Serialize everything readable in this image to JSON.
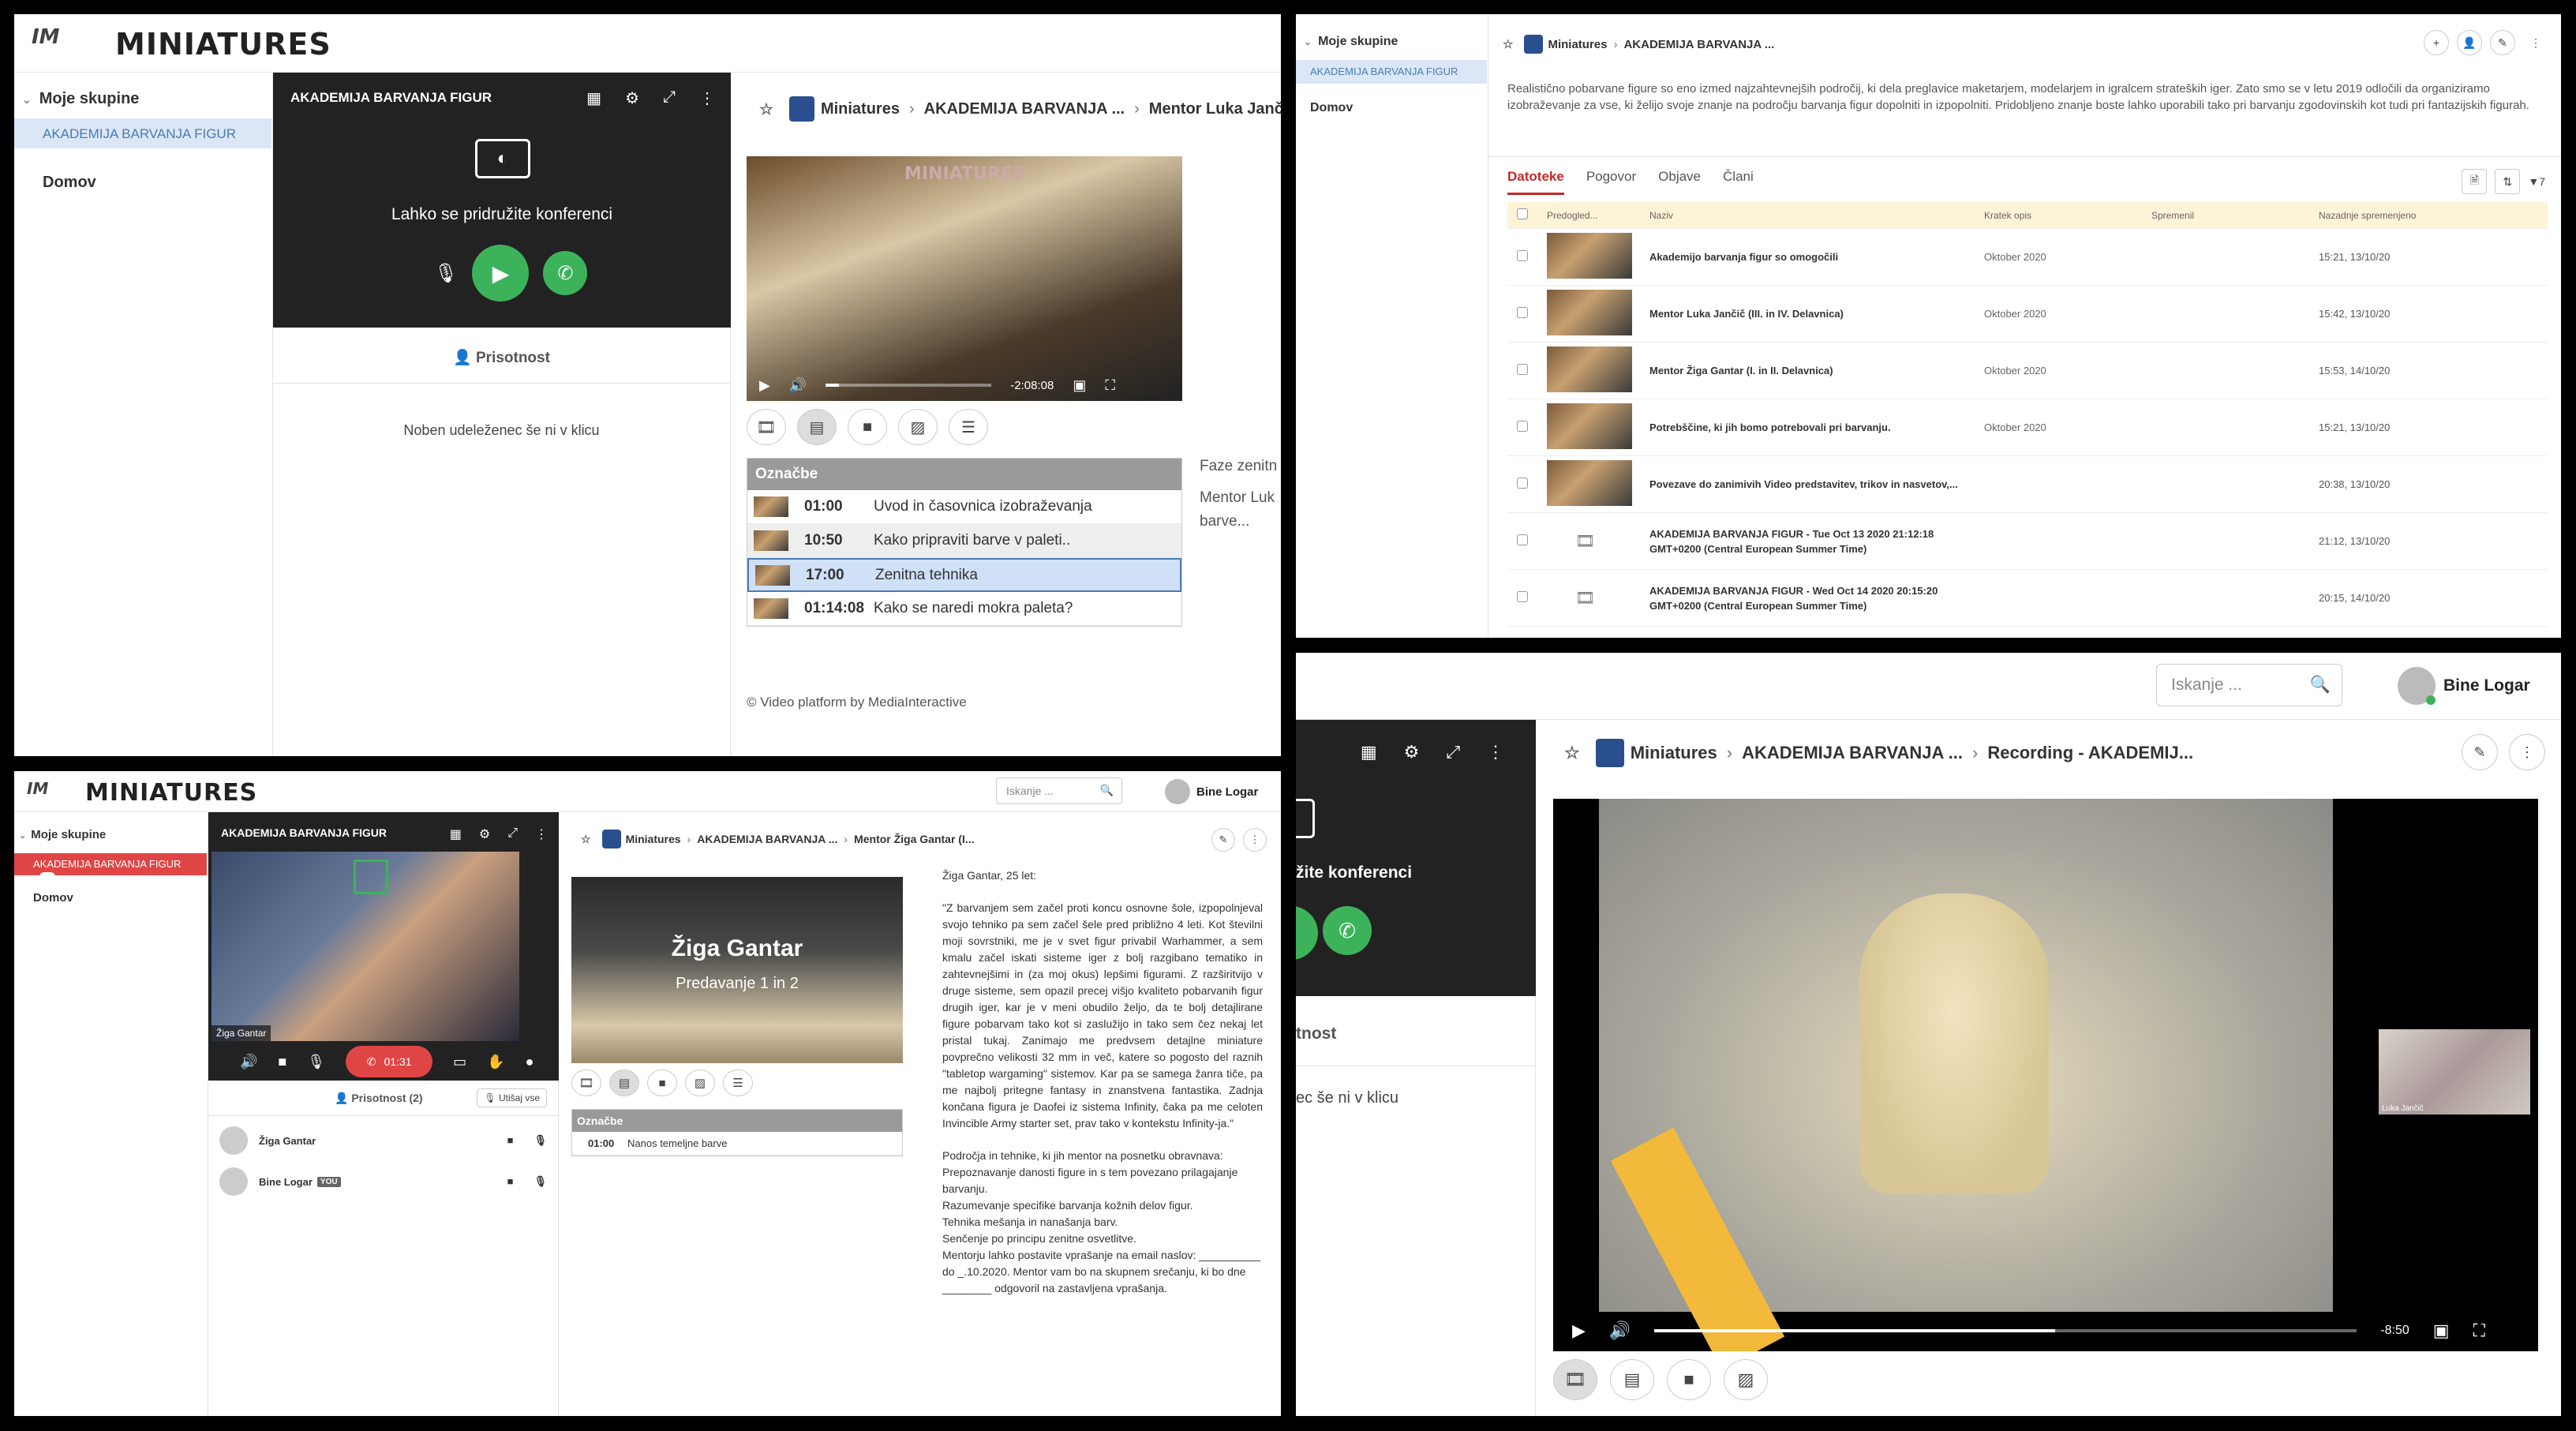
{
  "app": {
    "logo_text": "MINIATURES",
    "logo_mark": "IM",
    "sidebar_group_header": "Moje skupine",
    "sidebar_group_item": "AKADEMIJA BARVANJA FIGUR",
    "sidebar_home": "Domov",
    "search_placeholder": "Iskanje ...",
    "user_name": "Bine Logar"
  },
  "panel1": {
    "conf_title": "AKADEMIJA BARVANJA FIGUR",
    "join_text": "Lahko se pridružite konferenci",
    "attendance_label": "Prisotnost",
    "no_participants": "Noben udeleženec še ni v klicu",
    "breadcrumb": [
      "Miniatures",
      "AKADEMIJA BARVANJA ...",
      "Mentor Luka Jančič (II..."
    ],
    "video_time": "-2:08:08",
    "video_progress": 0.08,
    "markers_title": "Označbe",
    "markers": [
      {
        "time": "01:00",
        "label": "Uvod in časovnica izobraževanja"
      },
      {
        "time": "10:50",
        "label": "Kako pripraviti barve v paleti.."
      },
      {
        "time": "17:00",
        "label": "Zenitna tehnika"
      },
      {
        "time": "01:14:08",
        "label": "Kako se naredi mokra paleta?"
      }
    ],
    "side_text_1": "Faze zenitn",
    "side_text_2": "Mentor Luk",
    "side_text_3": "barve...",
    "footer": "© Video platform by MediaInteractive"
  },
  "panel2": {
    "breadcrumb": [
      "Miniatures",
      "AKADEMIJA BARVANJA ..."
    ],
    "description": "Realistično pobarvane figure so eno izmed najzahtevnejših področij, ki dela preglavice maketarjem, modelarjem in igralcem strateških iger. Zato smo se v letu 2019 odločili da organiziramo izobraževanje za vse, ki želijo svoje znanje na področju barvanja figur dopolniti in izpopolniti. Pridobljeno znanje boste lahko uporabili tako pri barvanju zgodovinskih kot tudi pri fantazijskih figurah.",
    "tabs": [
      "Datoteke",
      "Pogovor",
      "Objave",
      "Člani"
    ],
    "filter_count": "7",
    "columns": [
      "Predogled...",
      "Naziv",
      "Kratek opis",
      "Spremenil",
      "Nazadnje spremenjeno"
    ],
    "rows": [
      {
        "name": "Akademijo barvanja figur so omogočili",
        "desc": "Oktober 2020",
        "modified": "15:21, 13/10/20",
        "thumb": "image"
      },
      {
        "name": "Mentor Luka Jančič (III. in IV. Delavnica)",
        "desc": "Oktober 2020",
        "modified": "15:42, 13/10/20",
        "thumb": "image"
      },
      {
        "name": "Mentor Žiga Gantar (I. in II. Delavnica)",
        "desc": "Oktober 2020",
        "modified": "15:53, 14/10/20",
        "thumb": "image"
      },
      {
        "name": "Potrebščine, ki jih bomo potrebovali pri barvanju.",
        "desc": "Oktober 2020",
        "modified": "15:21, 13/10/20",
        "thumb": "image"
      },
      {
        "name": "Povezave do zanimivih Video predstavitev, trikov in nasvetov,...",
        "desc": "",
        "modified": "20:38, 13/10/20",
        "thumb": "image"
      },
      {
        "name": "AKADEMIJA BARVANJA FIGUR - Tue Oct 13 2020 21:12:18 GMT+0200 (Central European Summer Time)",
        "desc": "",
        "modified": "21:12, 13/10/20",
        "thumb": "film"
      },
      {
        "name": "AKADEMIJA BARVANJA FIGUR - Wed Oct 14 2020 20:15:20 GMT+0200 (Central European Summer Time)",
        "desc": "",
        "modified": "20:15, 14/10/20",
        "thumb": "film"
      }
    ]
  },
  "panel3": {
    "conf_title": "AKADEMIJA BARVANJA FIGUR",
    "speaker_label": "Žiga Gantar",
    "call_timer": "01:31",
    "attendance_label": "Prisotnost (2)",
    "mute_all": "Utišaj vse",
    "participants": [
      {
        "name": "Žiga Gantar",
        "you": ""
      },
      {
        "name": "Bine Logar",
        "you": "YOU"
      }
    ],
    "breadcrumb": [
      "Miniatures",
      "AKADEMIJA BARVANJA ...",
      "Mentor Žiga Gantar (I..."
    ],
    "video_title": "Žiga Gantar",
    "video_subtitle": "Predavanje 1 in 2",
    "markers_title": "Označbe",
    "markers": [
      {
        "time": "01:00",
        "label": "Nanos temeljne barve"
      }
    ],
    "bio_heading": "Žiga Gantar, 25 let:",
    "bio_paragraph": "\"Z barvanjem sem začel proti koncu osnovne šole, izpopolnjeval svojo tehniko pa sem začel šele pred približno 4 leti. Kot številni moji sovrstniki, me je v svet figur privabil Warhammer, a sem kmalu začel iskati sisteme iger z bolj razgibano tematiko in zahtevnejšimi in (za moj okus) lepšimi figurami. Z razširitvijo v druge sisteme, sem opazil precej višjo kvaliteto pobarvanih figur drugih iger, kar je v meni obudilo željo, da te bolj detajlirane figure pobarvam tako kot si zaslužijo in tako sem čez nekaj let pristal tukaj. Zanimajo me predvsem detajlne miniature povprečno velikosti 32 mm in več, katere so pogosto del raznih \"tabletop wargaming\" sistemov. Kar pa se samega žanra tiče, pa me najbolj pritegne fantasy in znanstvena fantastika. Zadnja končana figura je Daofei iz sistema Infinity, čaka pa me celoten Invincible Army starter set, prav tako v kontekstu Infinity-ja.\"",
    "bio_lines": [
      "Področja in tehnike, ki jih mentor na posnetku obravnava:",
      "Prepoznavanje danosti figure in s tem povezano prilagajanje barvanju.",
      "Razumevanje specifike barvanja kožnih delov figur.",
      "Tehnika mešanja in nanašanja barv.",
      "Senčenje po principu zenitne osvetlitve.",
      "Mentorju lahko postavite vprašanje na email naslov: __________ do _.10.2020. Mentor vam bo na skupnem srečanju, ki bo dne ________ odgovoril na zastavljena vprašanja."
    ]
  },
  "panel4": {
    "search_placeholder": "Iskanje ...",
    "user_name": "Bine Logar",
    "join_text_partial": "žite konferenci",
    "attendance_partial": "tnost",
    "no_participants_partial": "ec še ni v klicu",
    "breadcrumb": [
      "Miniatures",
      "AKADEMIJA BARVANJA ...",
      "Recording - AKADEMIJ..."
    ],
    "pip_label": "Luka Jančič",
    "video_time": "-8:50",
    "video_progress": 0.57
  }
}
